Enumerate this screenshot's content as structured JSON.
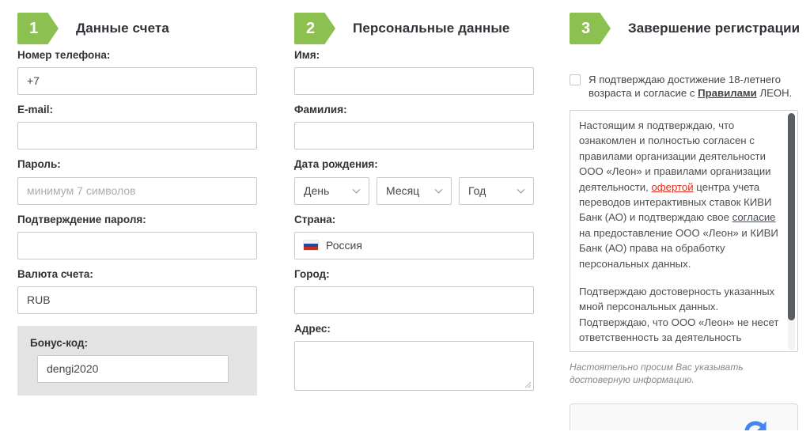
{
  "steps": [
    {
      "number": "1",
      "title": "Данные счета"
    },
    {
      "number": "2",
      "title": "Персональные данные"
    },
    {
      "number": "3",
      "title": "Завершение регистрации"
    }
  ],
  "account": {
    "phone_label": "Номер телефона:",
    "phone_value": "+7",
    "email_label": "E-mail:",
    "email_value": "",
    "password_label": "Пароль:",
    "password_placeholder": "минимум 7 символов",
    "password_confirm_label": "Подтверждение пароля:",
    "password_confirm_value": "",
    "currency_label": "Валюта счета:",
    "currency_value": "RUB",
    "bonus_label": "Бонус-код:",
    "bonus_value": "dengi2020"
  },
  "personal": {
    "first_name_label": "Имя:",
    "first_name_value": "",
    "last_name_label": "Фамилия:",
    "last_name_value": "",
    "birth_date_label": "Дата рождения:",
    "day_value": "День",
    "month_value": "Месяц",
    "year_value": "Год",
    "country_label": "Страна:",
    "country_value": "Россия",
    "city_label": "Город:",
    "city_value": "",
    "address_label": "Адрес:",
    "address_value": ""
  },
  "completion": {
    "consent_part1": "Я подтверждаю достижение 18-летнего возраста и согласие с ",
    "consent_rules_link": "Правилами",
    "consent_part2": " ЛЕОН.",
    "terms_p1_a": "Настоящим я подтверждаю, что ознакомлен и полностью согласен с правилами организации деятельности ООО «Леон» и правилами организации деятельности, ",
    "terms_p1_offer_link": "офертой",
    "terms_p1_b": " центра учета переводов интерактивных ставок КИВИ Банк (АО) и подтверждаю свое ",
    "terms_p1_consent_link": "согласие",
    "terms_p1_c": " на предоставление ООО «Леон» и КИВИ Банк (АО) права на обработку персональных данных.",
    "terms_p2": "Подтверждаю достоверность указанных мной персональных данных. Подтверждаю, что ООО «Леон» не несет ответственность за деятельность платежных систем, платежных агентов и любых других операторов",
    "note": "Настоятельно просим Вас указывать достоверную информацию."
  },
  "colors": {
    "badge_green": "#8cc152",
    "offer_link_red": "#e03020",
    "panel_gray": "#e3e3e3",
    "scrollbar_thumb": "#5a5e62"
  }
}
